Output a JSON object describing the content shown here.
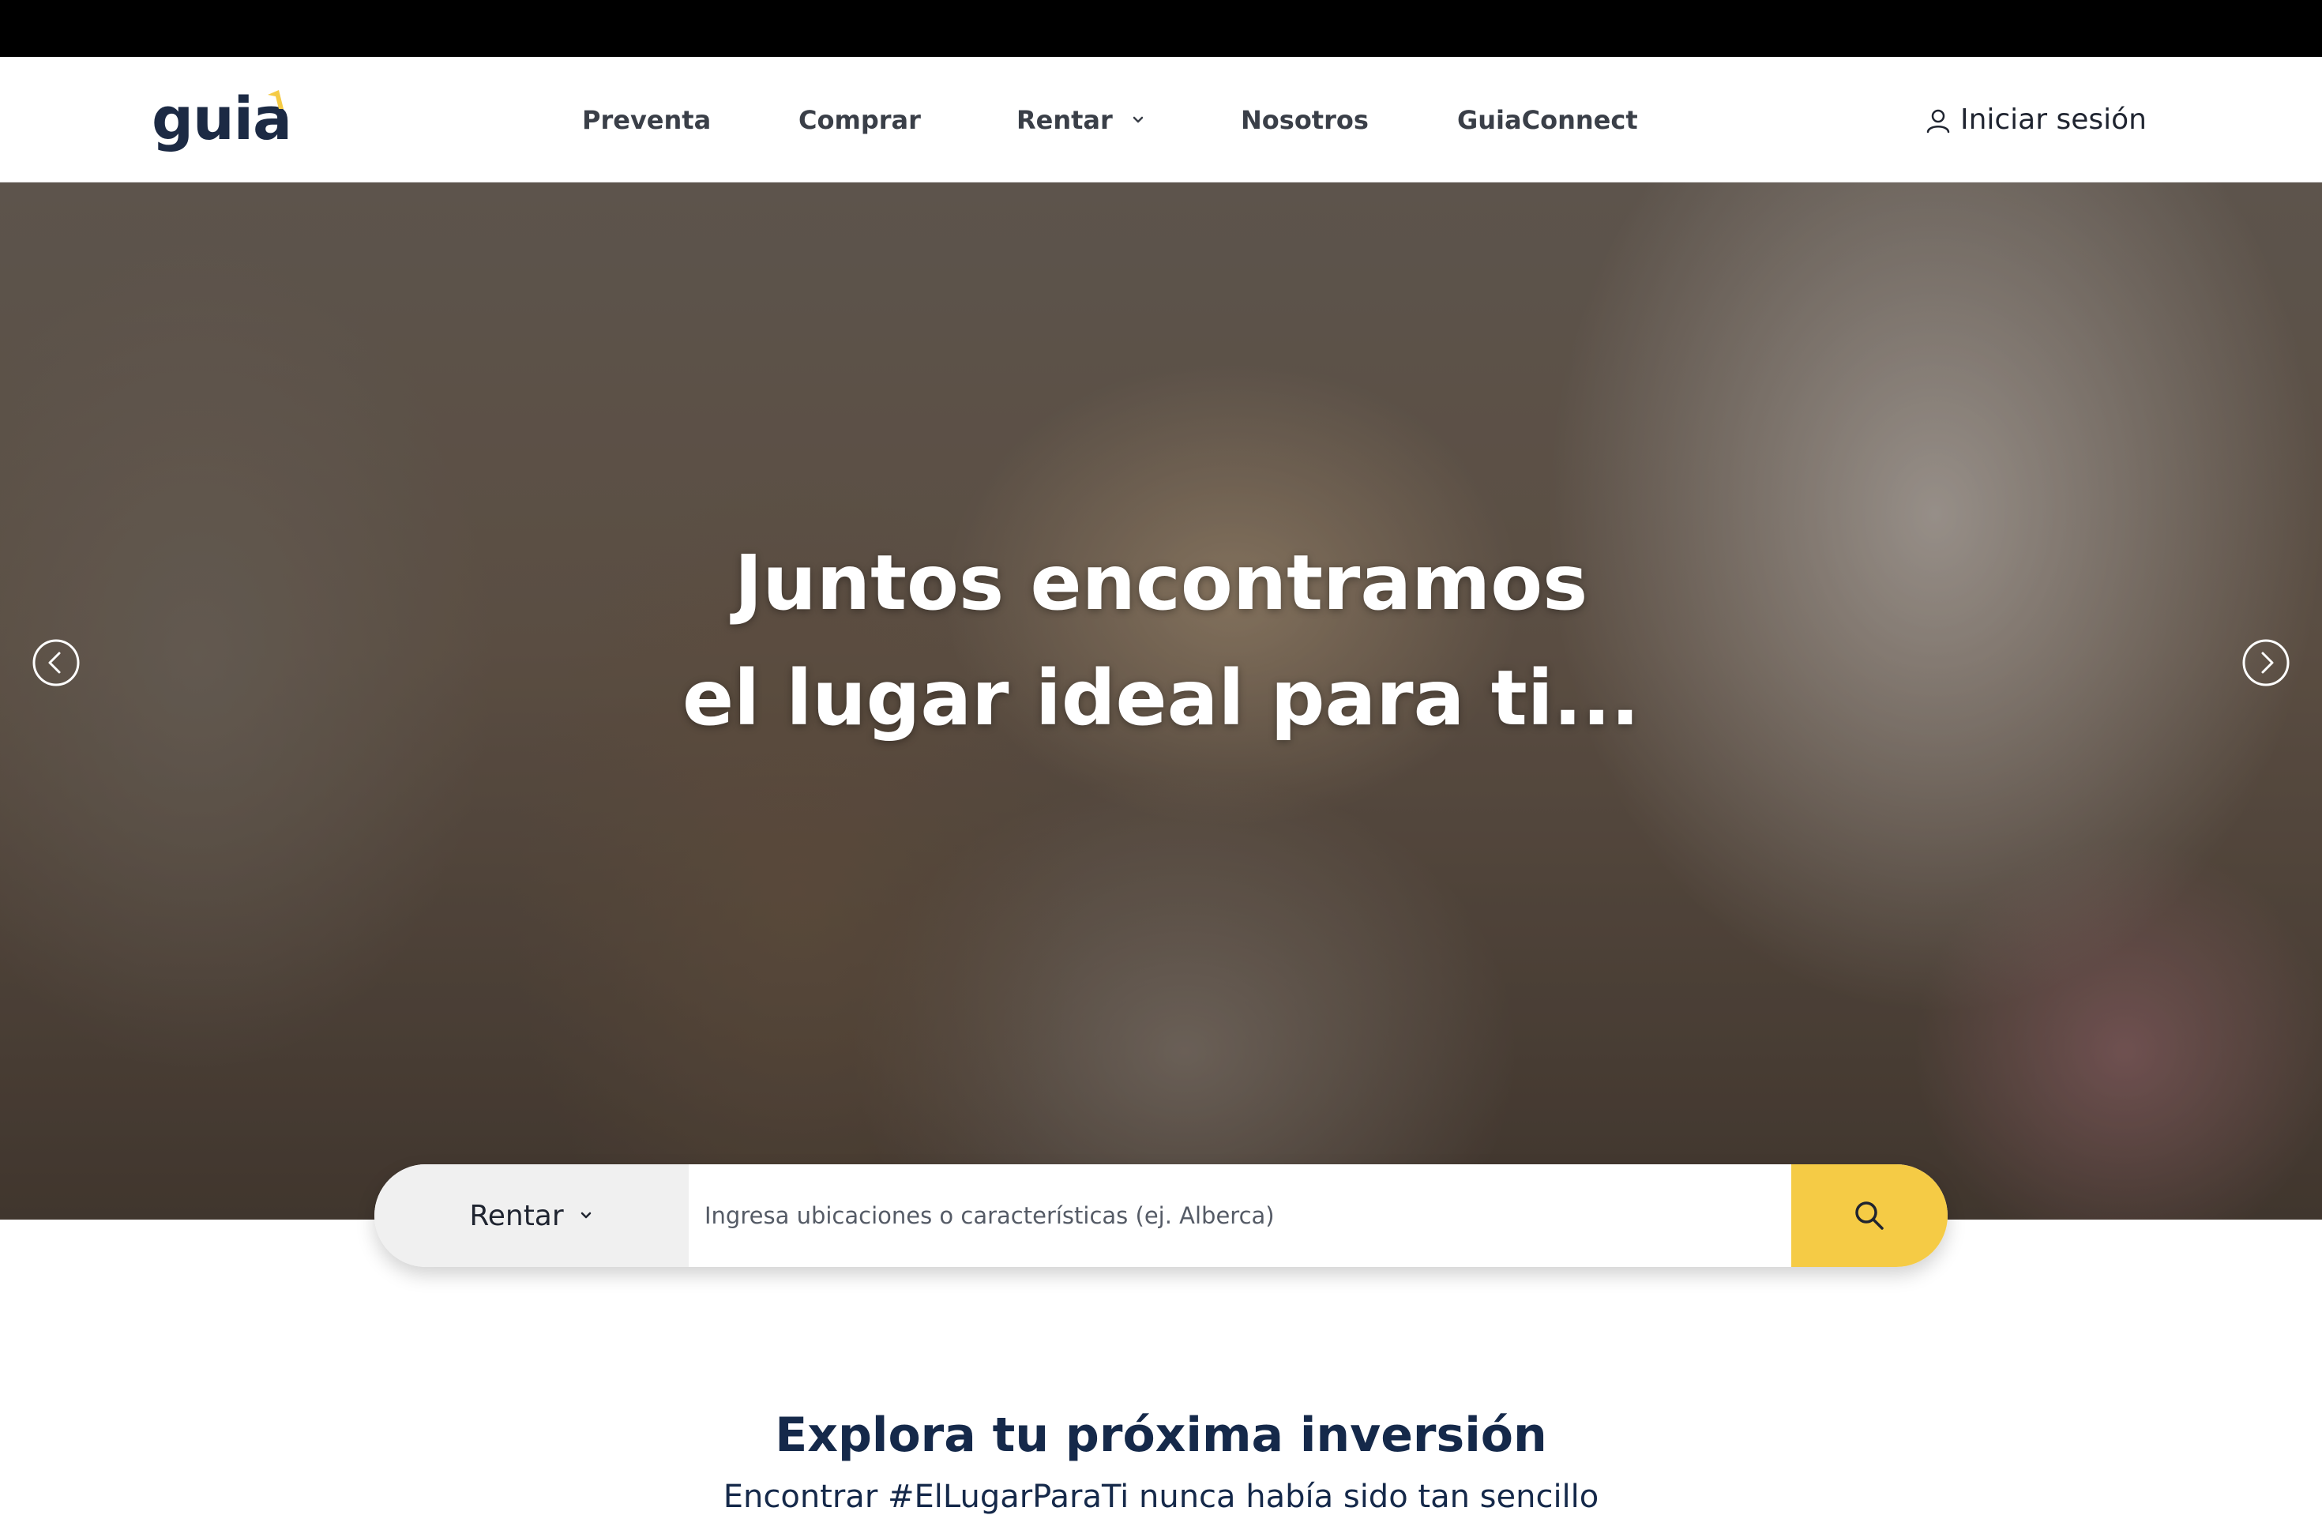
{
  "brand": {
    "logo_text": "guia",
    "primary_color": "#1c2a44",
    "accent_color": "#f5cb45"
  },
  "nav": {
    "items": [
      {
        "label": "Preventa"
      },
      {
        "label": "Comprar"
      },
      {
        "label": "Rentar",
        "has_dropdown": true
      },
      {
        "label": "Nosotros"
      },
      {
        "label": "GuiaConnect"
      }
    ],
    "login_label": "Iniciar sesión",
    "login_icon": "user-icon"
  },
  "hero": {
    "title_line1": "Juntos encontramos",
    "title_line2": "el lugar ideal para ti...",
    "prev_icon": "chevron-left-circle-icon",
    "next_icon": "chevron-right-circle-icon"
  },
  "search": {
    "type_selected": "Rentar",
    "placeholder": "Ingresa ubicaciones o características (ej. Alberca)",
    "button_icon": "search-icon"
  },
  "section": {
    "title": "Explora tu próxima inversión",
    "subtitle": "Encontrar #ElLugarParaTi nunca había sido tan sencillo"
  }
}
